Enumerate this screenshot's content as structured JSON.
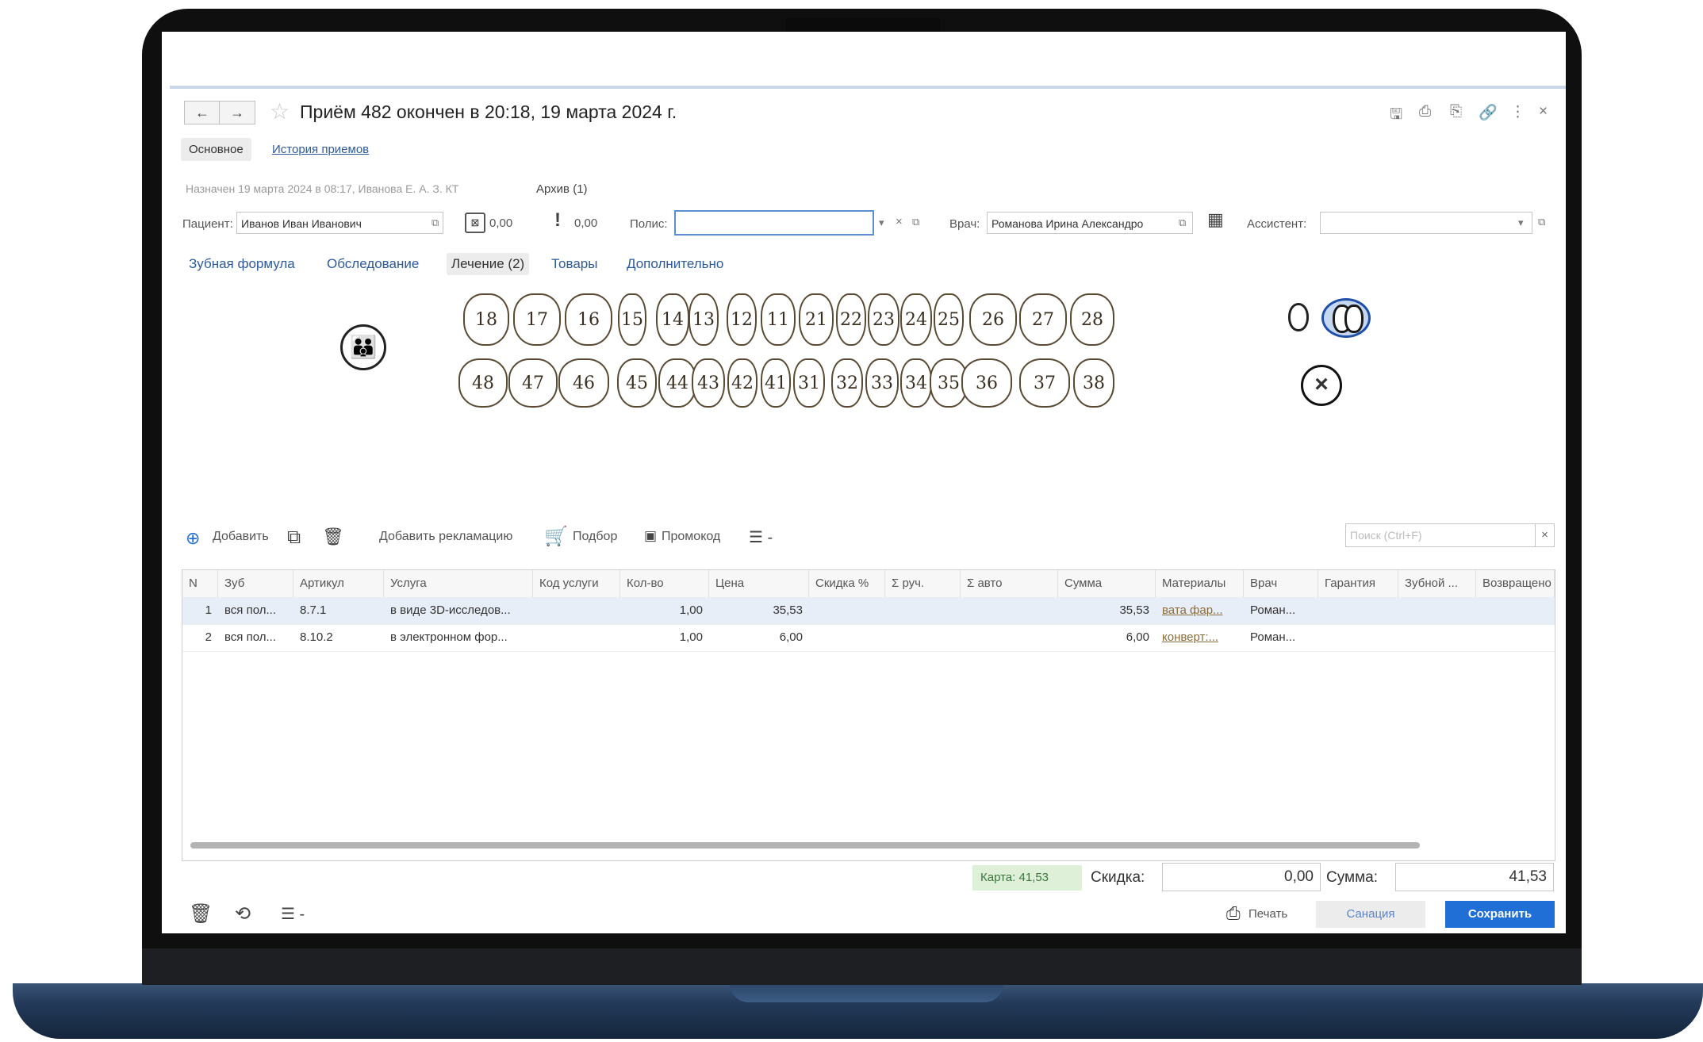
{
  "window": {
    "title": "Приём 482 окончен в 20:18, 19 марта 2024 г.",
    "back_icon": "←",
    "forward_icon": "→",
    "star_icon": "☆",
    "icons": {
      "save": "🖫",
      "print": "⎙",
      "preview": "⎘",
      "link": "🔗",
      "more": "⋮",
      "close": "×"
    }
  },
  "tabs": {
    "main": "Основное",
    "history": "История приемов"
  },
  "info": {
    "assigned": "Назначен 19 марта 2024  в 08:17, Иванова Е. А. З. КТ",
    "archive": "Архив (1)"
  },
  "patient": {
    "label": "Пациент:",
    "value": "Иванов Иван Иванович",
    "balance1": "0,00",
    "balance2": "0,00",
    "policy_label": "Полис:",
    "policy_value": "",
    "doctor_label": "Врач:",
    "doctor_value": "Романова Ирина Александро",
    "assistant_label": "Ассистент:",
    "assistant_value": ""
  },
  "subtabs": [
    "Зубная формула",
    "Обследование",
    "Лечение (2)",
    "Товары",
    "Дополнительно"
  ],
  "teeth": {
    "upper": [
      "18",
      "17",
      "16",
      "15",
      "14",
      "13",
      "12",
      "11",
      "21",
      "22",
      "23",
      "24",
      "25",
      "26",
      "27",
      "28"
    ],
    "lower": [
      "48",
      "47",
      "46",
      "45",
      "44",
      "43",
      "42",
      "41",
      "31",
      "32",
      "33",
      "34",
      "35",
      "36",
      "37",
      "38"
    ]
  },
  "toolbar": {
    "add": "Добавить",
    "claim": "Добавить рекламацию",
    "selection": "Подбор",
    "promo": "Промокод",
    "menu": "☰ -",
    "search_placeholder": "Поиск (Ctrl+F)"
  },
  "table": {
    "columns": [
      "N",
      "Зуб",
      "Артикул",
      "Услуга",
      "Код услуги",
      "Кол-во",
      "Цена",
      "Скидка %",
      "Σ руч.",
      "Σ авто",
      "Сумма",
      "Материалы",
      "Врач",
      "Гарантия",
      "Зубной ...",
      "Возвращено"
    ],
    "rows": [
      [
        "1",
        "вся пол...",
        "8.7.1",
        "в виде 3D-исследов...",
        "",
        "1,00",
        "35,53",
        "",
        "",
        "",
        "35,53",
        "вата фар...",
        "Роман...",
        "",
        "",
        ""
      ],
      [
        "2",
        "вся пол...",
        "8.10.2",
        "в электронном фор...",
        "",
        "1,00",
        "6,00",
        "",
        "",
        "",
        "6,00",
        "конверт:...",
        "Роман...",
        "",
        "",
        ""
      ]
    ]
  },
  "footer": {
    "card": "Карта: 41,53",
    "discount_label": "Скидка:",
    "discount_value": "0,00",
    "sum_label": "Сумма:",
    "sum_value": "41,53",
    "print": "Печать",
    "sanation": "Санация",
    "save": "Сохранить",
    "menu": "☰ -"
  },
  "colors": {
    "accent": "#1f6fd6",
    "link": "#2c5a9c",
    "card_bg": "#dff0d8"
  }
}
